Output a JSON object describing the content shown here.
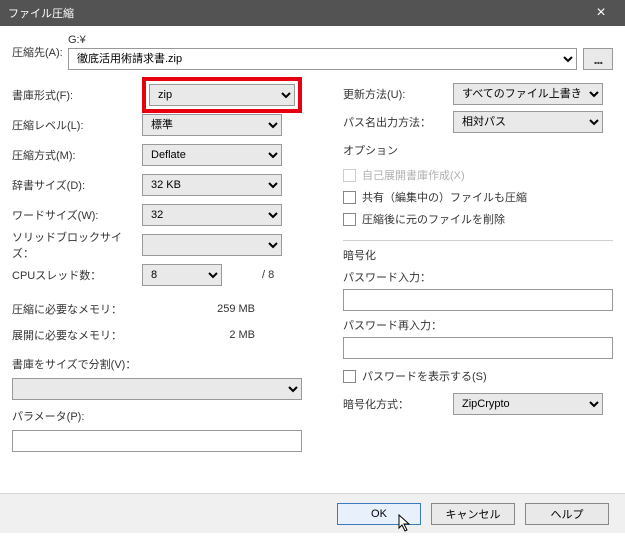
{
  "title": "ファイル圧縮",
  "dest": {
    "label": "圧縮先(A):",
    "drive": "G:¥",
    "path": "徹底活用術請求書.zip",
    "browse": "..."
  },
  "left": {
    "format": {
      "label": "書庫形式(F):",
      "value": "zip"
    },
    "level": {
      "label": "圧縮レベル(L):",
      "value": "標準"
    },
    "method": {
      "label": "圧縮方式(M):",
      "value": "Deflate"
    },
    "dict": {
      "label": "辞書サイズ(D):",
      "value": "32 KB"
    },
    "word": {
      "label": "ワードサイズ(W):",
      "value": "32"
    },
    "solid": {
      "label": "ソリッドブロックサイズ：",
      "value": ""
    },
    "cpu": {
      "label": "CPUスレッド数：",
      "value": "8",
      "suffix": "/ 8"
    },
    "mem_comp": {
      "label": "圧縮に必要なメモリ：",
      "value": "259 MB"
    },
    "mem_decomp": {
      "label": "展開に必要なメモリ：",
      "value": "2 MB"
    },
    "split": {
      "label": "書庫をサイズで分割(V)：",
      "value": ""
    },
    "params": {
      "label": "パラメータ(P):"
    }
  },
  "right": {
    "update": {
      "label": "更新方法(U):",
      "value": "すべてのファイル上書き"
    },
    "paths": {
      "label": "パス名出力方法：",
      "value": "相対パス"
    },
    "options": {
      "title": "オプション",
      "sfx": {
        "label": "自己展開書庫作成(X)",
        "checked": false,
        "disabled": true
      },
      "shared": {
        "label": "共有（編集中の）ファイルも圧縮",
        "checked": false
      },
      "del": {
        "label": "圧縮後に元のファイルを削除",
        "checked": false
      }
    },
    "encrypt": {
      "title": "暗号化",
      "pw1_label": "パスワード入力：",
      "pw2_label": "パスワード再入力：",
      "show": {
        "label": "パスワードを表示する(S)",
        "checked": false
      },
      "method": {
        "label": "暗号化方式：",
        "value": "ZipCrypto"
      }
    }
  },
  "footer": {
    "ok": "OK",
    "cancel": "キャンセル",
    "help": "ヘルプ"
  }
}
